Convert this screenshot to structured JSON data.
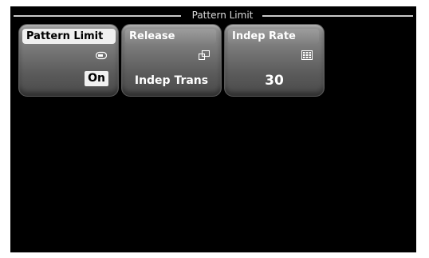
{
  "menu": {
    "title": "Pattern Limit"
  },
  "buttons": [
    {
      "label": "Pattern Limit",
      "value": "On",
      "icon": "toggle-icon",
      "selected": true
    },
    {
      "label": "Release",
      "value": "Indep Trans",
      "icon": "window-overlap-icon",
      "selected": false
    },
    {
      "label": "Indep Rate",
      "value": "30",
      "icon": "keypad-icon",
      "selected": false
    }
  ]
}
